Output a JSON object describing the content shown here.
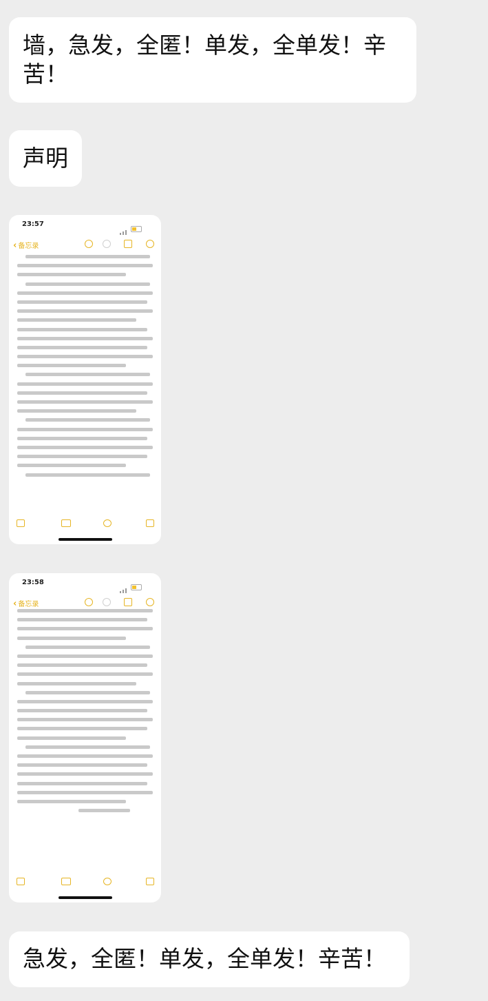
{
  "messages": {
    "msg1": "墙，急发，全匿！单发，全单发！辛苦！",
    "msg2": "声明",
    "msg5": "急发，全匿！单发，全单发！辛苦！"
  },
  "screenshots": [
    {
      "time": "23:57",
      "back_label": "备忘录",
      "paragraph_count": 5
    },
    {
      "time": "23:58",
      "back_label": "备忘录",
      "paragraph_count": 5
    }
  ],
  "colors": {
    "background": "#ededed",
    "bubble": "#ffffff",
    "accent": "#e6b422",
    "text": "#111111"
  },
  "icons": [
    "back-chevron-icon",
    "undo-icon",
    "more-icon",
    "share-icon",
    "ellipsis-icon",
    "checklist-icon",
    "camera-icon",
    "compose-icon"
  ]
}
